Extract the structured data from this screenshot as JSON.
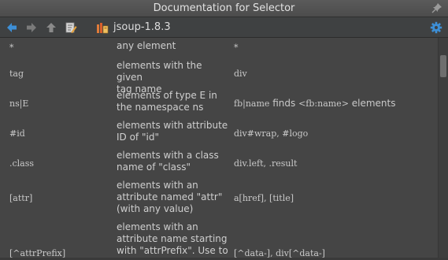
{
  "window": {
    "title": "Documentation for Selector"
  },
  "toolbar": {
    "label": "jsoup-1.8.3"
  },
  "icons": {
    "back": "back-arrow-icon",
    "forward": "forward-arrow-icon",
    "up": "up-arrow-icon",
    "edit": "edit-source-icon",
    "library": "library-icon",
    "settings": "gear-icon",
    "pin": "pin-icon"
  },
  "colors": {
    "accent": "#3d8fd6",
    "background": "#454545"
  },
  "rows": [
    {
      "pattern": "*",
      "desc": [
        "any element"
      ],
      "example": "*"
    },
    {
      "pattern": "tag",
      "desc": [
        "elements with the given",
        "tag name"
      ],
      "example": "div"
    },
    {
      "pattern": "ns|E",
      "desc": [
        "elements of type E in",
        "the namespace ns"
      ],
      "example_code": "fb|name",
      "example_text": " finds ",
      "example_code2": "<fb:name>",
      "example_text2": " elements"
    },
    {
      "pattern": "#id",
      "desc": [
        "elements with attribute",
        "ID of \"id\""
      ],
      "example": "div#wrap, #logo"
    },
    {
      "pattern": ".class",
      "desc": [
        "elements with a class",
        "name of \"class\""
      ],
      "example": "div.left, .result"
    },
    {
      "pattern": "[attr]",
      "desc": [
        "elements with an",
        "attribute named \"attr\"",
        "(with any value)"
      ],
      "example": "a[href], [title]"
    },
    {
      "pattern": "[^attrPrefix]",
      "desc": [
        "elements with an",
        "attribute name starting",
        "with \"attrPrefix\". Use to"
      ],
      "example": "[^data-], div[^data-]"
    }
  ]
}
